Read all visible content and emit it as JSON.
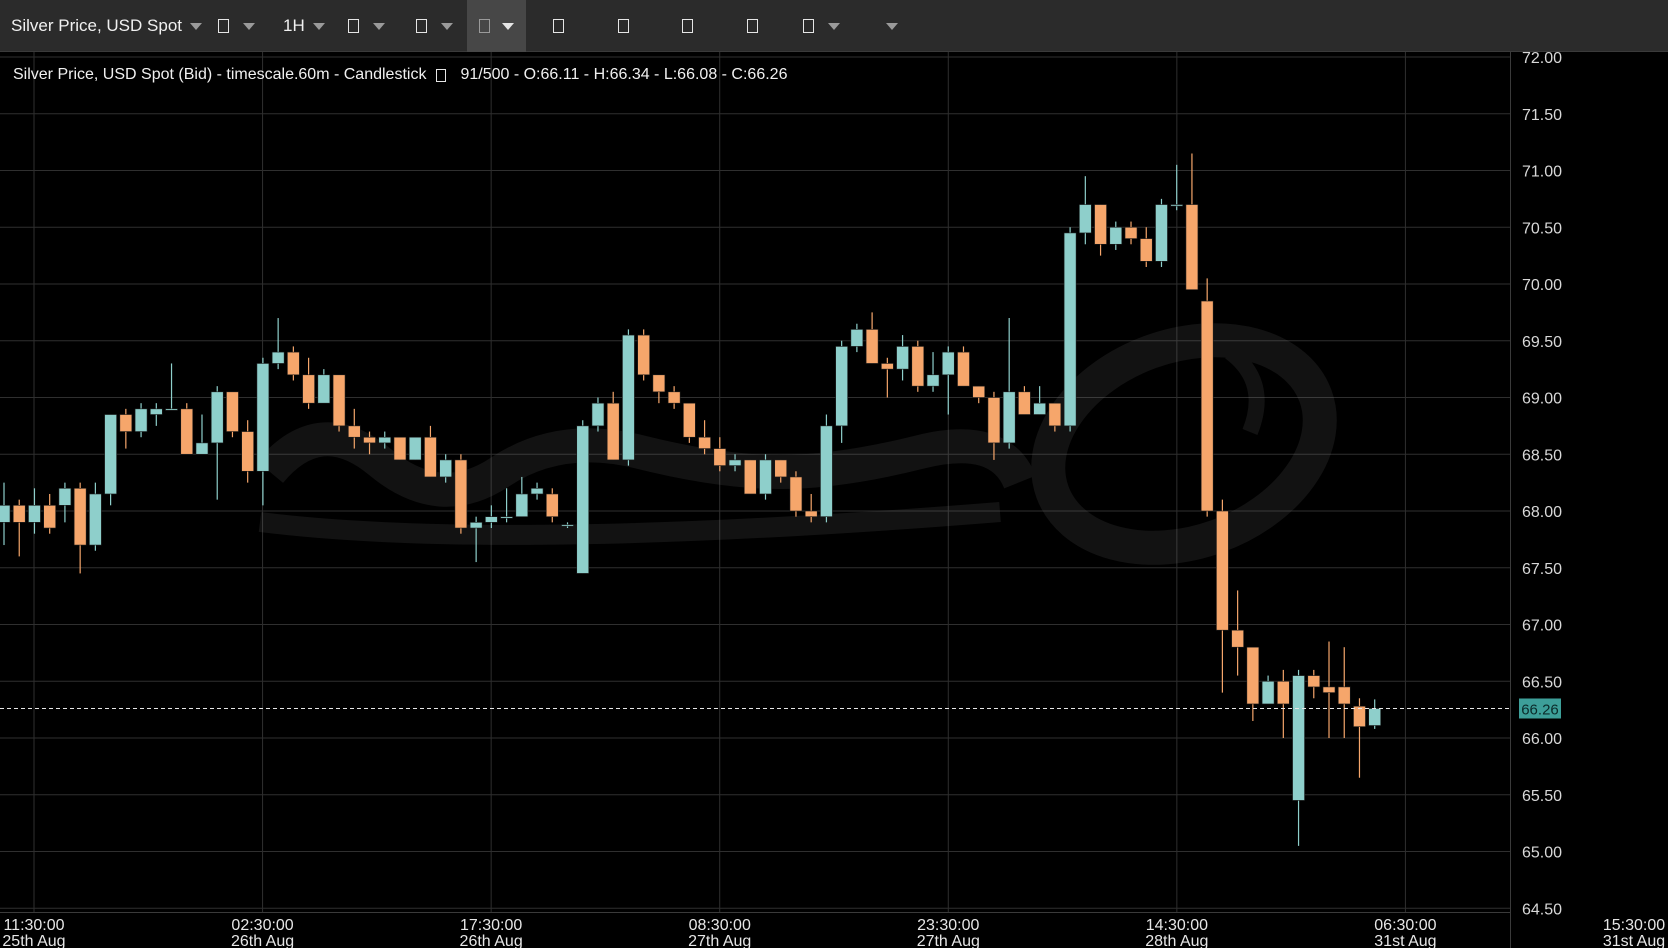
{
  "toolbar": {
    "symbol": "Silver Price, USD Spot",
    "timeframe": "1H",
    "buttons": [
      {
        "icon": "chart-type-icon"
      },
      {
        "icon": "indicators-icon"
      },
      {
        "icon": "drawing-tools-icon"
      },
      {
        "icon": "crosshair-icon"
      },
      {
        "icon": "zoom-in-icon"
      },
      {
        "icon": "zoom-out-icon"
      },
      {
        "icon": "reset-view-icon"
      },
      {
        "icon": "screenshot-icon"
      },
      {
        "icon": "settings-icon"
      },
      {
        "icon": "more-icon"
      }
    ]
  },
  "info": {
    "title": "Silver Price, USD Spot (Bid) - timescale.60m - Candlestick",
    "counter": "91/500",
    "ohlc": "O:66.11 - H:66.34 - L:66.08 - C:66.26"
  },
  "colors": {
    "up": "#8ecfcb",
    "down": "#f6a66b",
    "grid": "#2f2f2f",
    "last_price_tag": "#3d9f99"
  },
  "chart_data": {
    "type": "candlestick",
    "title": "Silver Price, USD Spot (Bid) - timescale.60m - Candlestick",
    "ylim": [
      64.3,
      72.0
    ],
    "y_ticks": [
      "72.00",
      "71.50",
      "71.00",
      "70.50",
      "70.00",
      "69.50",
      "69.00",
      "68.50",
      "68.00",
      "67.50",
      "67.00",
      "66.50",
      "66.00",
      "65.50",
      "65.00",
      "64.50"
    ],
    "x_ticks": [
      {
        "time": "11:30:00",
        "date": "25th Aug"
      },
      {
        "time": "02:30:00",
        "date": "26th Aug"
      },
      {
        "time": "17:30:00",
        "date": "26th Aug"
      },
      {
        "time": "08:30:00",
        "date": "27th Aug"
      },
      {
        "time": "23:30:00",
        "date": "27th Aug"
      },
      {
        "time": "14:30:00",
        "date": "28th Aug"
      },
      {
        "time": "06:30:00",
        "date": "31st Aug"
      },
      {
        "time": "15:30:00",
        "date": "31st Aug"
      }
    ],
    "last_price": "66.26",
    "candles": [
      [
        67.9,
        68.05,
        68.25,
        67.7
      ],
      [
        68.05,
        67.9,
        68.1,
        67.6
      ],
      [
        67.9,
        68.05,
        68.2,
        67.8
      ],
      [
        68.05,
        67.85,
        68.15,
        67.8
      ],
      [
        68.05,
        68.2,
        68.25,
        67.9
      ],
      [
        68.2,
        67.7,
        68.25,
        67.45
      ],
      [
        67.7,
        68.15,
        68.25,
        67.65
      ],
      [
        68.15,
        68.85,
        68.85,
        68.05
      ],
      [
        68.85,
        68.7,
        68.9,
        68.55
      ],
      [
        68.7,
        68.9,
        68.95,
        68.65
      ],
      [
        68.85,
        68.9,
        68.95,
        68.75
      ],
      [
        68.9,
        68.9,
        69.3,
        68.9
      ],
      [
        68.9,
        68.5,
        68.95,
        68.5
      ],
      [
        68.5,
        68.6,
        68.85,
        68.5
      ],
      [
        68.6,
        69.05,
        69.1,
        68.1
      ],
      [
        69.05,
        68.7,
        69.05,
        68.65
      ],
      [
        68.7,
        68.35,
        68.8,
        68.25
      ],
      [
        68.35,
        69.3,
        69.35,
        68.05
      ],
      [
        69.3,
        69.4,
        69.7,
        69.25
      ],
      [
        69.4,
        69.2,
        69.45,
        69.15
      ],
      [
        69.2,
        68.95,
        69.35,
        68.9
      ],
      [
        68.95,
        69.2,
        69.25,
        68.95
      ],
      [
        69.2,
        68.75,
        69.2,
        68.7
      ],
      [
        68.75,
        68.65,
        68.9,
        68.55
      ],
      [
        68.65,
        68.6,
        68.7,
        68.5
      ],
      [
        68.6,
        68.65,
        68.7,
        68.55
      ],
      [
        68.65,
        68.45,
        68.65,
        68.45
      ],
      [
        68.45,
        68.65,
        68.65,
        68.45
      ],
      [
        68.65,
        68.3,
        68.75,
        68.3
      ],
      [
        68.3,
        68.45,
        68.5,
        68.25
      ],
      [
        68.45,
        67.85,
        68.5,
        67.8
      ],
      [
        67.85,
        67.9,
        67.95,
        67.55
      ],
      [
        67.9,
        67.95,
        68.05,
        67.85
      ],
      [
        67.95,
        67.95,
        68.2,
        67.9
      ],
      [
        67.95,
        68.15,
        68.3,
        67.95
      ],
      [
        68.15,
        68.2,
        68.25,
        68.1
      ],
      [
        68.15,
        67.95,
        68.2,
        67.9
      ],
      [
        67.87,
        67.88,
        67.9,
        67.85
      ],
      [
        67.45,
        68.75,
        68.8,
        67.45
      ],
      [
        68.75,
        68.95,
        69.0,
        68.7
      ],
      [
        68.95,
        68.45,
        69.05,
        68.45
      ],
      [
        68.45,
        69.55,
        69.6,
        68.4
      ],
      [
        69.55,
        69.2,
        69.6,
        69.15
      ],
      [
        69.2,
        69.05,
        69.2,
        68.95
      ],
      [
        69.05,
        68.95,
        69.1,
        68.9
      ],
      [
        68.95,
        68.65,
        68.95,
        68.6
      ],
      [
        68.65,
        68.55,
        68.8,
        68.5
      ],
      [
        68.55,
        68.4,
        68.65,
        68.35
      ],
      [
        68.4,
        68.45,
        68.5,
        68.35
      ],
      [
        68.45,
        68.15,
        68.45,
        68.15
      ],
      [
        68.15,
        68.45,
        68.5,
        68.1
      ],
      [
        68.45,
        68.3,
        68.45,
        68.25
      ],
      [
        68.3,
        68.0,
        68.35,
        67.95
      ],
      [
        68.0,
        67.95,
        68.15,
        67.9
      ],
      [
        67.95,
        68.75,
        68.85,
        67.9
      ],
      [
        68.75,
        69.45,
        69.5,
        68.6
      ],
      [
        69.45,
        69.6,
        69.65,
        69.4
      ],
      [
        69.6,
        69.3,
        69.75,
        69.3
      ],
      [
        69.3,
        69.25,
        69.35,
        69.0
      ],
      [
        69.25,
        69.45,
        69.55,
        69.15
      ],
      [
        69.45,
        69.1,
        69.5,
        69.05
      ],
      [
        69.1,
        69.2,
        69.4,
        69.05
      ],
      [
        69.2,
        69.4,
        69.45,
        68.85
      ],
      [
        69.4,
        69.1,
        69.45,
        69.1
      ],
      [
        69.1,
        69.0,
        69.1,
        68.95
      ],
      [
        69.0,
        68.6,
        69.05,
        68.45
      ],
      [
        68.6,
        69.05,
        69.7,
        68.55
      ],
      [
        69.05,
        68.85,
        69.1,
        68.85
      ],
      [
        68.85,
        68.95,
        69.1,
        68.85
      ],
      [
        68.95,
        68.75,
        68.95,
        68.7
      ],
      [
        68.75,
        70.45,
        70.5,
        68.7
      ],
      [
        70.45,
        70.7,
        70.95,
        70.35
      ],
      [
        70.7,
        70.35,
        70.7,
        70.25
      ],
      [
        70.35,
        70.5,
        70.55,
        70.3
      ],
      [
        70.5,
        70.4,
        70.55,
        70.35
      ],
      [
        70.4,
        70.2,
        70.5,
        70.15
      ],
      [
        70.2,
        70.7,
        70.75,
        70.15
      ],
      [
        70.7,
        70.7,
        71.05,
        70.65
      ],
      [
        70.7,
        69.95,
        71.15,
        69.95
      ],
      [
        69.85,
        68.0,
        70.05,
        67.95
      ],
      [
        68.0,
        66.95,
        68.1,
        66.4
      ],
      [
        66.95,
        66.8,
        67.3,
        66.55
      ],
      [
        66.8,
        66.3,
        66.8,
        66.15
      ],
      [
        66.3,
        66.5,
        66.55,
        66.3
      ],
      [
        66.5,
        66.3,
        66.6,
        66.0
      ],
      [
        65.45,
        66.55,
        66.6,
        65.05
      ],
      [
        66.55,
        66.45,
        66.6,
        66.35
      ],
      [
        66.45,
        66.4,
        66.85,
        66.0
      ],
      [
        66.45,
        66.3,
        66.8,
        66.0
      ],
      [
        66.28,
        66.1,
        66.35,
        65.65
      ],
      [
        66.11,
        66.26,
        66.34,
        66.08
      ]
    ]
  }
}
